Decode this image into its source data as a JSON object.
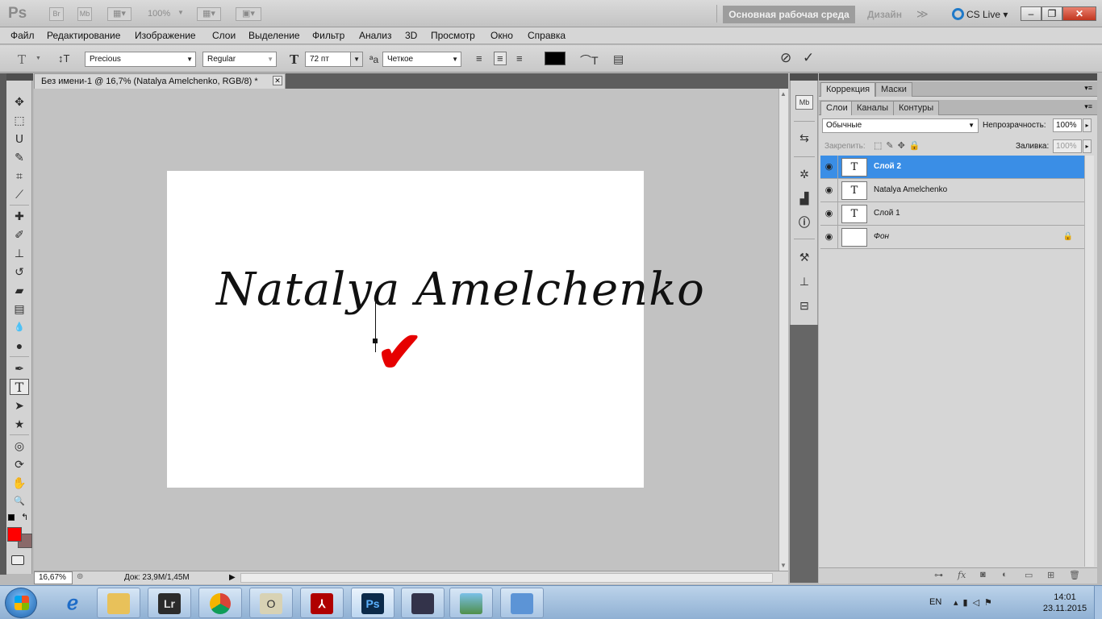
{
  "app": {
    "logo": "Ps",
    "bridge_label": "Br",
    "minibridge_label": "Mb",
    "zoom_level": "100%",
    "workspace_active": "Основная рабочая среда",
    "workspace_design": "Дизайн",
    "workspace_more": "≫",
    "cs_live": "CS Live",
    "minimize": "–",
    "restore": "❐",
    "close": "✕"
  },
  "menu": [
    "Файл",
    "Редактирование",
    "Изображение",
    "Слои",
    "Выделение",
    "Фильтр",
    "Анализ",
    "3D",
    "Просмотр",
    "Окно",
    "Справка"
  ],
  "options": {
    "tool_glyph": "T",
    "font_family": "Precious",
    "font_style": "Regular",
    "font_size": "72 пт",
    "antialias_label": "ªa",
    "antialias": "Четкое",
    "text_color": "#000000",
    "cancel_glyph": "⊘",
    "commit_glyph": "✓"
  },
  "document": {
    "tab_title": "Без имени-1 @ 16,7% (Natalya Amelchenko, RGB/8) *",
    "tab_close": "✕",
    "text": "Natalya Amelchenko",
    "check_glyph": "✔"
  },
  "tools": [
    {
      "name": "move",
      "glyph": "✥"
    },
    {
      "name": "marquee",
      "glyph": "⬚"
    },
    {
      "name": "lasso",
      "glyph": "ᑌ"
    },
    {
      "name": "quick-select",
      "glyph": "✎"
    },
    {
      "name": "crop",
      "glyph": "⌗"
    },
    {
      "name": "eyedropper",
      "glyph": "⟋"
    },
    {
      "name": "healing",
      "glyph": "✚"
    },
    {
      "name": "brush",
      "glyph": "✐"
    },
    {
      "name": "stamp",
      "glyph": "⊥"
    },
    {
      "name": "history-brush",
      "glyph": "↺"
    },
    {
      "name": "eraser",
      "glyph": "▰"
    },
    {
      "name": "gradient",
      "glyph": "▤"
    },
    {
      "name": "blur",
      "glyph": "💧"
    },
    {
      "name": "dodge",
      "glyph": "●"
    },
    {
      "name": "pen",
      "glyph": "✒"
    },
    {
      "name": "type",
      "glyph": "T"
    },
    {
      "name": "path-select",
      "glyph": "➤"
    },
    {
      "name": "shape",
      "glyph": "★"
    },
    {
      "name": "3d-rotate",
      "glyph": "◎"
    },
    {
      "name": "3d-orbit",
      "glyph": "⟳"
    },
    {
      "name": "hand",
      "glyph": "✋"
    },
    {
      "name": "zoom",
      "glyph": "🔍"
    }
  ],
  "colors": {
    "foreground": "#ff0000",
    "background": "#8a6a6a",
    "accent_check": "#e60000",
    "selection": "#3a8ee6"
  },
  "status": {
    "zoom": "16,67%",
    "doc_size": "Док: 23,9M/1,45M",
    "play": "▶"
  },
  "panels": {
    "top_tabs": [
      "Коррекция",
      "Маски"
    ],
    "layer_tabs": [
      "Слои",
      "Каналы",
      "Контуры"
    ],
    "blend_mode": "Обычные",
    "opacity_label": "Непрозрачность:",
    "opacity": "100%",
    "lock_label": "Закрепить:",
    "fill_label": "Заливка:",
    "fill": "100%",
    "layers": [
      {
        "name": "Слой 2",
        "thumb": "T",
        "selected": true
      },
      {
        "name": "Natalya Amelchenko",
        "thumb": "T",
        "selected": false
      },
      {
        "name": "Слой 1",
        "thumb": "T",
        "selected": false
      },
      {
        "name": "Фон",
        "thumb": "",
        "selected": false,
        "locked": true
      }
    ]
  },
  "dock_icons": [
    "mini-bridge-icon",
    "history-icon",
    "navigator-icon",
    "histogram-icon",
    "info-icon",
    "tool-presets-icon",
    "clone-source-icon",
    "actions-icon"
  ],
  "taskbar": {
    "apps": [
      "Internet Explorer",
      "Проводник",
      "Lr",
      "Chrome",
      "O",
      "Acrobat",
      "Ps",
      "Media",
      "Photos",
      "Control"
    ],
    "lr": "Lr",
    "ps": "Ps",
    "o": "O",
    "lang": "EN",
    "time": "14:01",
    "date": "23.11.2015"
  }
}
